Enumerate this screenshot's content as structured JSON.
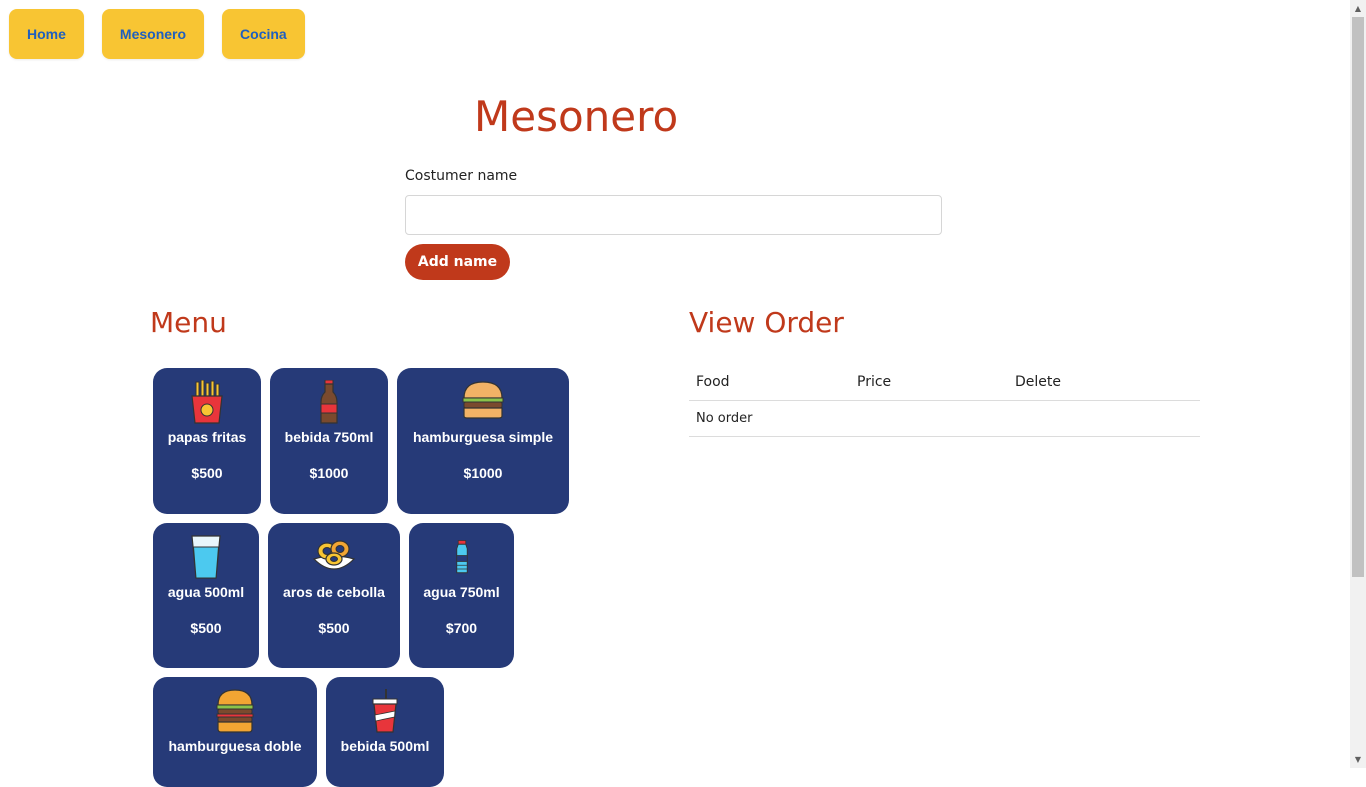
{
  "nav": {
    "home": "Home",
    "mesonero": "Mesonero",
    "cocina": "Cocina"
  },
  "page_title": "Mesonero",
  "customer_form": {
    "label": "Costumer name",
    "value": "",
    "placeholder": "",
    "add_button": "Add name"
  },
  "menu": {
    "title": "Menu",
    "items": [
      {
        "name": "papas fritas",
        "price": "$500",
        "icon": "fries-icon"
      },
      {
        "name": "bebida 750ml",
        "price": "$1000",
        "icon": "cola-bottle-icon"
      },
      {
        "name": "hamburguesa simple",
        "price": "$1000",
        "icon": "burger-icon"
      },
      {
        "name": "agua 500ml",
        "price": "$500",
        "icon": "water-glass-icon"
      },
      {
        "name": "aros de cebolla",
        "price": "$500",
        "icon": "onion-rings-icon"
      },
      {
        "name": "agua 750ml",
        "price": "$700",
        "icon": "water-bottle-icon"
      },
      {
        "name": "hamburguesa doble",
        "price": "",
        "icon": "double-burger-icon"
      },
      {
        "name": "bebida 500ml",
        "price": "",
        "icon": "soda-cup-icon"
      }
    ]
  },
  "order": {
    "title": "View Order",
    "columns": [
      "Food",
      "Price",
      "Delete"
    ],
    "empty_text": "No order"
  },
  "colors": {
    "nav_button": "#f8c533",
    "nav_text": "#1f5fbf",
    "accent": "#c0391b",
    "card": "#263a78"
  }
}
